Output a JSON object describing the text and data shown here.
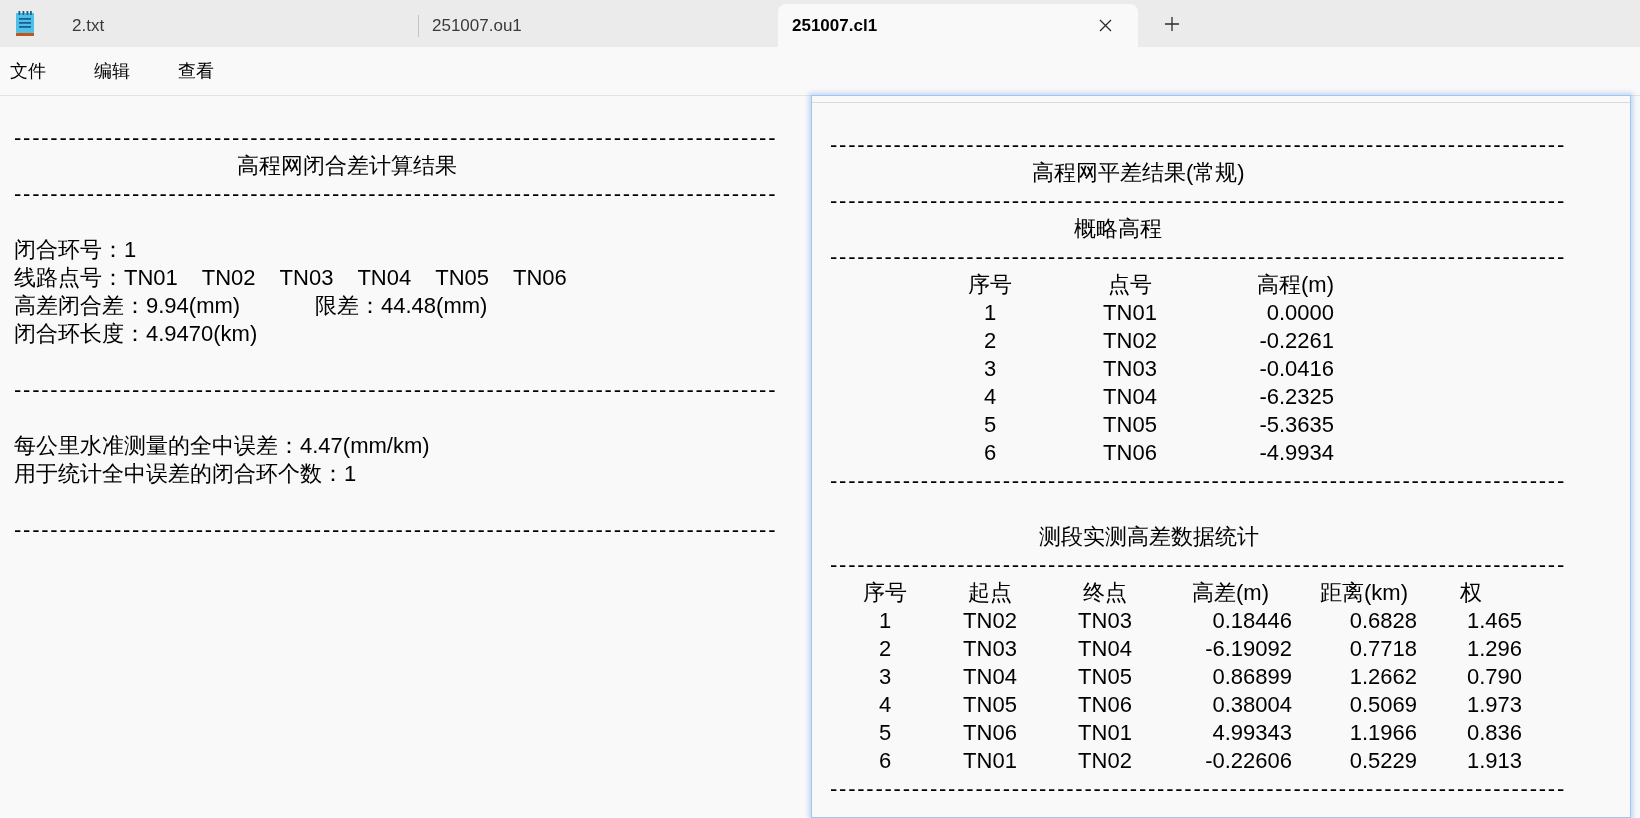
{
  "tabs": [
    {
      "label": "2.txt",
      "selected": false
    },
    {
      "label": "251007.ou1",
      "selected": false
    },
    {
      "label": "251007.cl1",
      "selected": true
    }
  ],
  "menu": [
    "文件",
    "编辑",
    "查看"
  ],
  "editor": {
    "lines": [
      {
        "kind": "blank"
      },
      {
        "kind": "rule",
        "text": "------------------------------------------------------------------------------------"
      },
      {
        "kind": "title",
        "text": "高程网闭合差计算结果"
      },
      {
        "kind": "rule",
        "text": "------------------------------------------------------------------------------------"
      },
      {
        "kind": "blank"
      },
      {
        "kind": "field",
        "text": "闭合环号：1"
      },
      {
        "kind": "points",
        "label": "线路点号：",
        "points": [
          "TN01",
          "TN02",
          "TN03",
          "TN04",
          "TN05",
          "TN06"
        ]
      },
      {
        "kind": "pair",
        "items": [
          "高差闭合差：9.94(mm)",
          "限差：44.48(mm)"
        ]
      },
      {
        "kind": "field",
        "text": "闭合环长度：4.9470(km)"
      },
      {
        "kind": "blank"
      },
      {
        "kind": "rule",
        "text": "------------------------------------------------------------------------------------"
      },
      {
        "kind": "blank"
      },
      {
        "kind": "field",
        "text": "每公里水准测量的全中误差：4.47(mm/km)"
      },
      {
        "kind": "field",
        "text": "用于统计全中误差的闭合环个数：1"
      },
      {
        "kind": "blank"
      },
      {
        "kind": "rule",
        "text": "------------------------------------------------------------------------------------"
      }
    ]
  },
  "floating_window": {
    "lines": [
      {
        "kind": "blank"
      },
      {
        "kind": "rule",
        "text": "---------------------------------------------------------------------------------"
      },
      {
        "kind": "title",
        "text": "高程网平差结果(常规)"
      },
      {
        "kind": "rule",
        "text": "---------------------------------------------------------------------------------"
      },
      {
        "kind": "heading",
        "text": "概略高程"
      },
      {
        "kind": "rule",
        "text": "---------------------------------------------------------------------------------"
      },
      {
        "kind": "table",
        "columns": [
          "序号",
          "点号",
          "高程(m)"
        ],
        "rows": [
          [
            "1",
            "TN01",
            "0.0000"
          ],
          [
            "2",
            "TN02",
            "-0.2261"
          ],
          [
            "3",
            "TN03",
            "-0.0416"
          ],
          [
            "4",
            "TN04",
            "-6.2325"
          ],
          [
            "5",
            "TN05",
            "-5.3635"
          ],
          [
            "6",
            "TN06",
            "-4.9934"
          ]
        ]
      },
      {
        "kind": "rule",
        "text": "---------------------------------------------------------------------------------"
      },
      {
        "kind": "blank"
      },
      {
        "kind": "heading",
        "text": "测段实测高差数据统计"
      },
      {
        "kind": "rule",
        "text": "---------------------------------------------------------------------------------"
      },
      {
        "kind": "table",
        "columns": [
          "序号",
          "起点",
          "终点",
          "高差(m)",
          "距离(km)",
          "权"
        ],
        "rows": [
          [
            "1",
            "TN02",
            "TN03",
            "0.18446",
            "0.6828",
            "1.465"
          ],
          [
            "2",
            "TN03",
            "TN04",
            "-6.19092",
            "0.7718",
            "1.296"
          ],
          [
            "3",
            "TN04",
            "TN05",
            "0.86899",
            "1.2662",
            "0.790"
          ],
          [
            "4",
            "TN05",
            "TN06",
            "0.38004",
            "0.5069",
            "1.973"
          ],
          [
            "5",
            "TN06",
            "TN01",
            "4.99343",
            "1.1966",
            "0.836"
          ],
          [
            "6",
            "TN01",
            "TN02",
            "-0.22606",
            "0.5229",
            "1.913"
          ]
        ]
      },
      {
        "kind": "rule",
        "text": "---------------------------------------------------------------------------------"
      }
    ]
  }
}
